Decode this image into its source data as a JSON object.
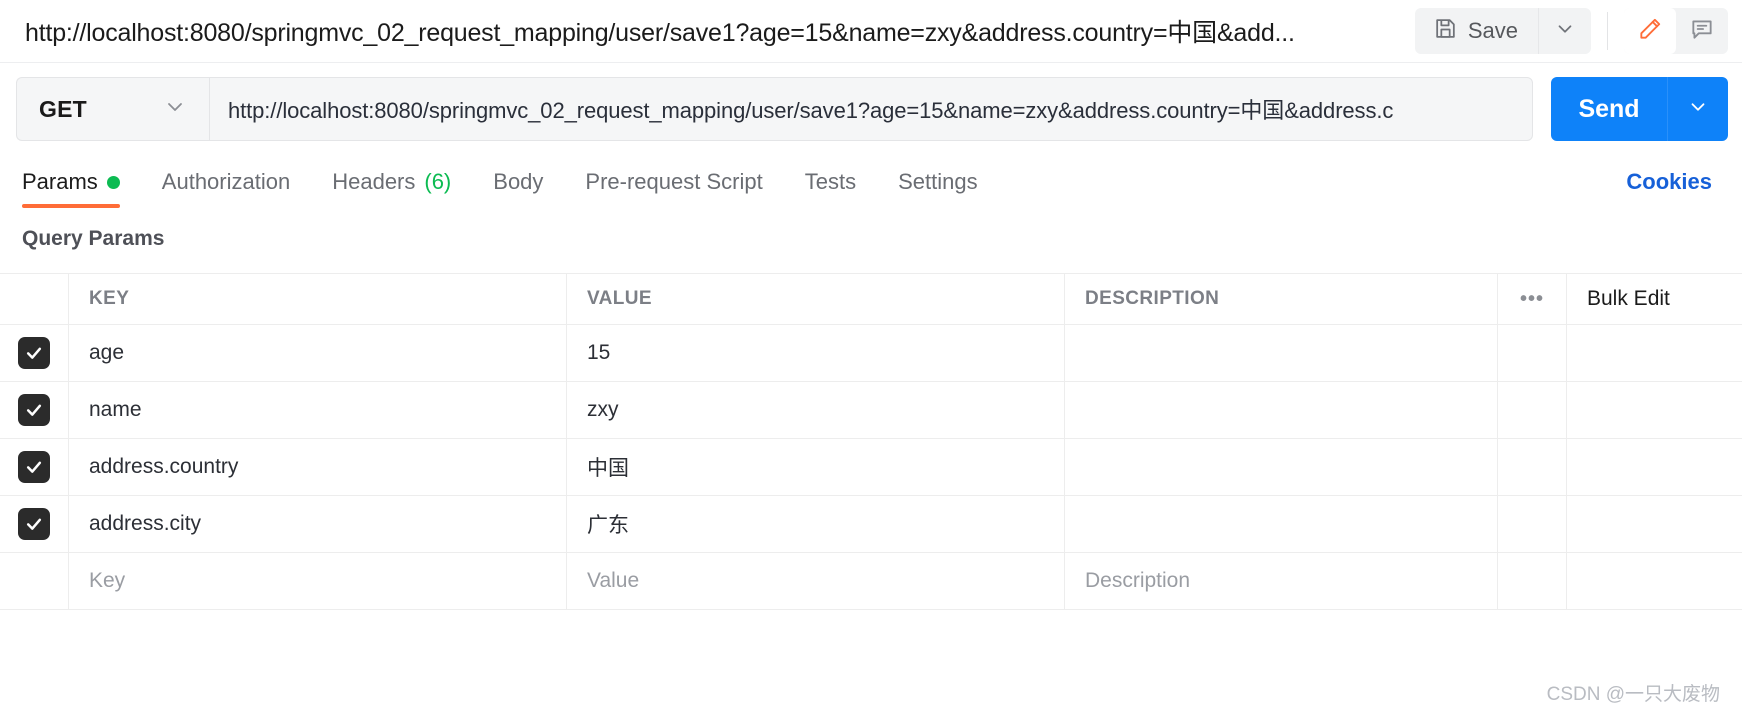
{
  "topbar": {
    "request_title": "http://localhost:8080/springmvc_02_request_mapping/user/save1?age=15&name=zxy&address.country=中国&add...",
    "save_label": "Save",
    "save_caret_icon": "chevron-down-icon",
    "save_icon": "floppy-disk-icon",
    "edit_icon": "pencil-icon",
    "comment_icon": "comment-icon",
    "accent_orange": "#ff6c37"
  },
  "request": {
    "method": "GET",
    "method_caret_icon": "chevron-down-icon",
    "url": "http://localhost:8080/springmvc_02_request_mapping/user/save1?age=15&name=zxy&address.country=中国&address.c",
    "send_label": "Send",
    "send_caret_icon": "chevron-down-icon",
    "send_color": "#0e82f9"
  },
  "tabs": [
    {
      "label": "Params",
      "active": true,
      "dot": true,
      "count": ""
    },
    {
      "label": "Authorization",
      "active": false,
      "dot": false,
      "count": ""
    },
    {
      "label": "Headers",
      "active": false,
      "dot": false,
      "count": "(6)"
    },
    {
      "label": "Body",
      "active": false,
      "dot": false,
      "count": ""
    },
    {
      "label": "Pre-request Script",
      "active": false,
      "dot": false,
      "count": ""
    },
    {
      "label": "Tests",
      "active": false,
      "dot": false,
      "count": ""
    },
    {
      "label": "Settings",
      "active": false,
      "dot": false,
      "count": ""
    }
  ],
  "cookies_label": "Cookies",
  "params": {
    "section_title": "Query Params",
    "columns": {
      "key": "KEY",
      "value": "VALUE",
      "description": "DESCRIPTION"
    },
    "more_icon": "ellipsis-icon",
    "more_glyph": "•••",
    "bulk_edit_label": "Bulk Edit",
    "rows": [
      {
        "checked": true,
        "key": "age",
        "value": "15",
        "description": ""
      },
      {
        "checked": true,
        "key": "name",
        "value": "zxy",
        "description": ""
      },
      {
        "checked": true,
        "key": "address.country",
        "value": "中国",
        "description": ""
      },
      {
        "checked": true,
        "key": "address.city",
        "value": "广东",
        "description": ""
      }
    ],
    "new_row": {
      "key_placeholder": "Key",
      "value_placeholder": "Value",
      "description_placeholder": "Description"
    }
  },
  "watermark": "CSDN @一只大废物"
}
